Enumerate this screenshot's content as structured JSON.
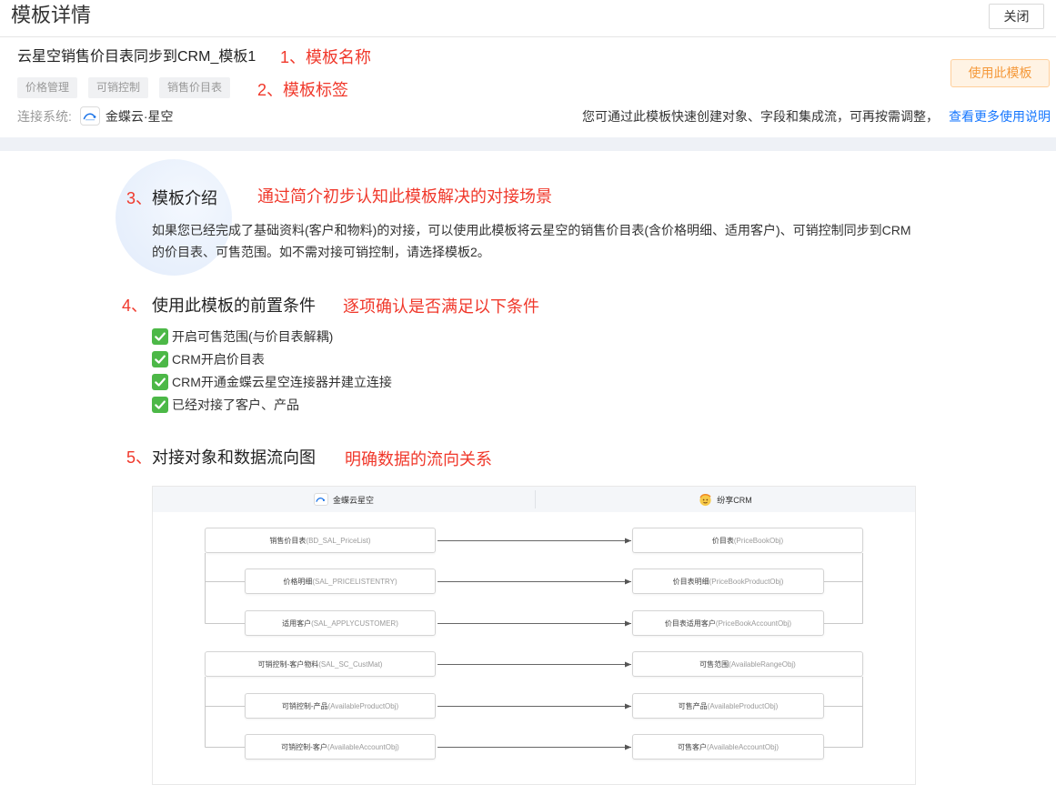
{
  "header": {
    "title": "模板详情",
    "close_label": "关闭"
  },
  "template": {
    "name": "云星空销售价目表同步到CRM_模板1",
    "tags": [
      "价格管理",
      "可销控制",
      "销售价目表"
    ],
    "connect_label": "连接系统:",
    "connect_system": "金蝶云·星空",
    "use_button": "使用此模板",
    "hint": "您可通过此模板快速创建对象、字段和集成流，可再按需调整，",
    "help_link": "查看更多使用说明"
  },
  "annotations": {
    "a1": "1、模板名称",
    "a2": "2、模板标签",
    "a3": "通过简介初步认知此模板解决的对接场景",
    "a4": "逐项确认是否满足以下条件",
    "a5": "明确数据的流向关系"
  },
  "intro": {
    "number": "3、",
    "title": "模板介绍",
    "lines": [
      "如果您已经完成了基础资料(客户和物料)的对接，可以使用此模板将云星空的销售价目表(含价格明细、适用客户)、可销控制同步到CRM",
      "的价目表、可售范围。如不需对接可销控制，请选择模板2。"
    ]
  },
  "prerequisites": {
    "number": "4、",
    "title": "使用此模板的前置条件",
    "items": [
      "开启可售范围(与价目表解耦)",
      "CRM开启价目表",
      "CRM开通金蝶云星空连接器并建立连接",
      "已经对接了客户、产品"
    ]
  },
  "flow": {
    "number": "5、",
    "title": "对接对象和数据流向图",
    "source_system": "金蝶云星空",
    "target_system": "纷享CRM",
    "groups": [
      {
        "parent": {
          "source": {
            "label": "销售价目表",
            "api": "(BD_SAL_PriceList)"
          },
          "target": {
            "label": "价目表",
            "api": "(PriceBookObj)"
          }
        },
        "children": [
          {
            "source": {
              "label": "价格明细",
              "api": "(SAL_PRICELISTENTRY)"
            },
            "target": {
              "label": "价目表明细",
              "api": "(PriceBookProductObj)"
            }
          },
          {
            "source": {
              "label": "适用客户",
              "api": "(SAL_APPLYCUSTOMER)"
            },
            "target": {
              "label": "价目表适用客户",
              "api": "(PriceBookAccountObj)"
            }
          }
        ]
      },
      {
        "parent": {
          "source": {
            "label": "可销控制-客户物料",
            "api": "(SAL_SC_CustMat)"
          },
          "target": {
            "label": "可售范围",
            "api": "(AvailableRangeObj)"
          }
        },
        "children": [
          {
            "source": {
              "label": "可销控制-产品",
              "api": "(AvailableProductObj)"
            },
            "target": {
              "label": "可售产品",
              "api": "(AvailableProductObj)"
            }
          },
          {
            "source": {
              "label": "可销控制-客户",
              "api": "(AvailableAccountObj)"
            },
            "target": {
              "label": "可售客户",
              "api": "(AvailableAccountObj)"
            }
          }
        ]
      }
    ]
  },
  "icons": {
    "check": "check-icon",
    "source_logo": "kingdee-logo",
    "target_logo": "fxiaoke-logo"
  },
  "colors": {
    "annotation_red": "#f0382b",
    "link_blue": "#1677ff",
    "use_button_orange": "#f59a3c",
    "check_green": "#4cb847",
    "band_gray": "#eef1f6"
  }
}
